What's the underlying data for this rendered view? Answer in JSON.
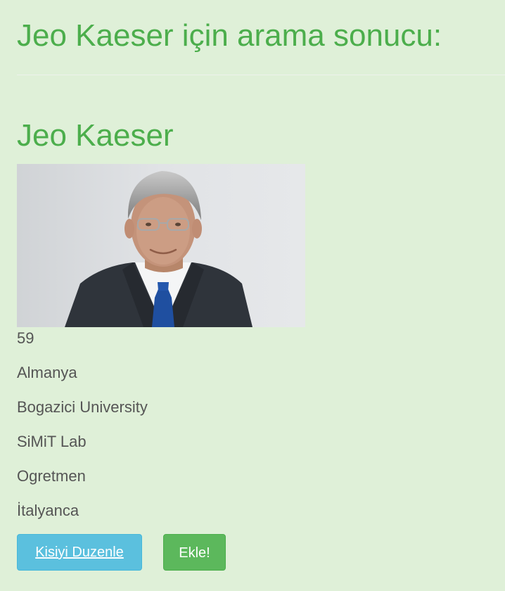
{
  "search": {
    "heading": "Jeo Kaeser için arama sonucu:"
  },
  "person": {
    "name": "Jeo Kaeser",
    "photo_alt": "Jeo Kaeser",
    "age": "59",
    "country": "Almanya",
    "university": "Bogazici University",
    "lab": "SiMiT Lab",
    "role": "Ogretmen",
    "language": "İtalyanca"
  },
  "actions": {
    "edit_label": "Kisiyi Duzenle",
    "add_label": "Ekle!"
  },
  "colors": {
    "background": "#dff0d8",
    "heading": "#4cae4c",
    "info_button": "#5bc0de",
    "success_button": "#5cb85c"
  }
}
